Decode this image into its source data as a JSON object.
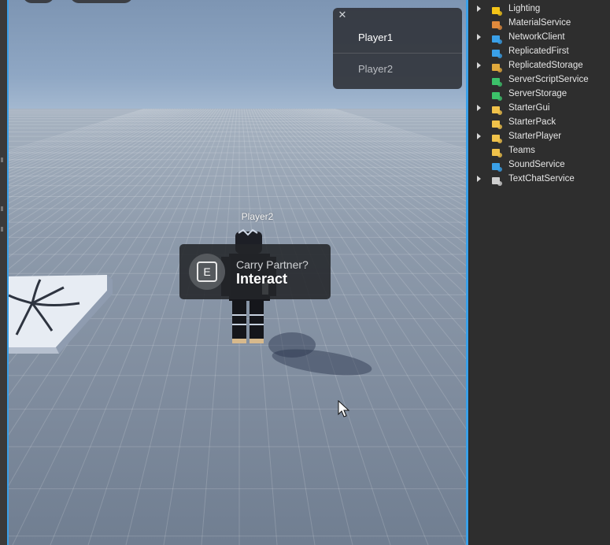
{
  "player_list": {
    "close_glyph": "✕",
    "players": [
      "Player1",
      "Player2"
    ]
  },
  "character": {
    "name_tag": "Player2"
  },
  "prompt": {
    "key": "E",
    "object_text": "Carry Partner?",
    "action_text": "Interact"
  },
  "explorer": {
    "items": [
      {
        "label": "Lighting",
        "expandable": true,
        "icon": "lightbulb-icon",
        "color": "#f5c518"
      },
      {
        "label": "MaterialService",
        "expandable": false,
        "icon": "material-icon",
        "color": "#e08a3c"
      },
      {
        "label": "NetworkClient",
        "expandable": true,
        "icon": "network-icon",
        "color": "#3aa0e8"
      },
      {
        "label": "ReplicatedFirst",
        "expandable": false,
        "icon": "replicated-first-icon",
        "color": "#3aa0e8"
      },
      {
        "label": "ReplicatedStorage",
        "expandable": true,
        "icon": "replicated-storage-icon",
        "color": "#e0a93c"
      },
      {
        "label": "ServerScriptService",
        "expandable": false,
        "icon": "server-script-icon",
        "color": "#3cc26a"
      },
      {
        "label": "ServerStorage",
        "expandable": false,
        "icon": "server-storage-icon",
        "color": "#3cc26a"
      },
      {
        "label": "StarterGui",
        "expandable": true,
        "icon": "starter-gui-icon",
        "color": "#f0c24a"
      },
      {
        "label": "StarterPack",
        "expandable": false,
        "icon": "starter-pack-icon",
        "color": "#f0c24a"
      },
      {
        "label": "StarterPlayer",
        "expandable": true,
        "icon": "starter-player-icon",
        "color": "#f0c24a"
      },
      {
        "label": "Teams",
        "expandable": false,
        "icon": "teams-icon",
        "color": "#f0c24a"
      },
      {
        "label": "SoundService",
        "expandable": false,
        "icon": "sound-icon",
        "color": "#3aa0e8"
      },
      {
        "label": "TextChatService",
        "expandable": true,
        "icon": "text-chat-icon",
        "color": "#cfcfcf"
      }
    ]
  },
  "colors": {
    "viewport_border": "#3aa0e8",
    "panel_bg": "#2e2e2e"
  }
}
